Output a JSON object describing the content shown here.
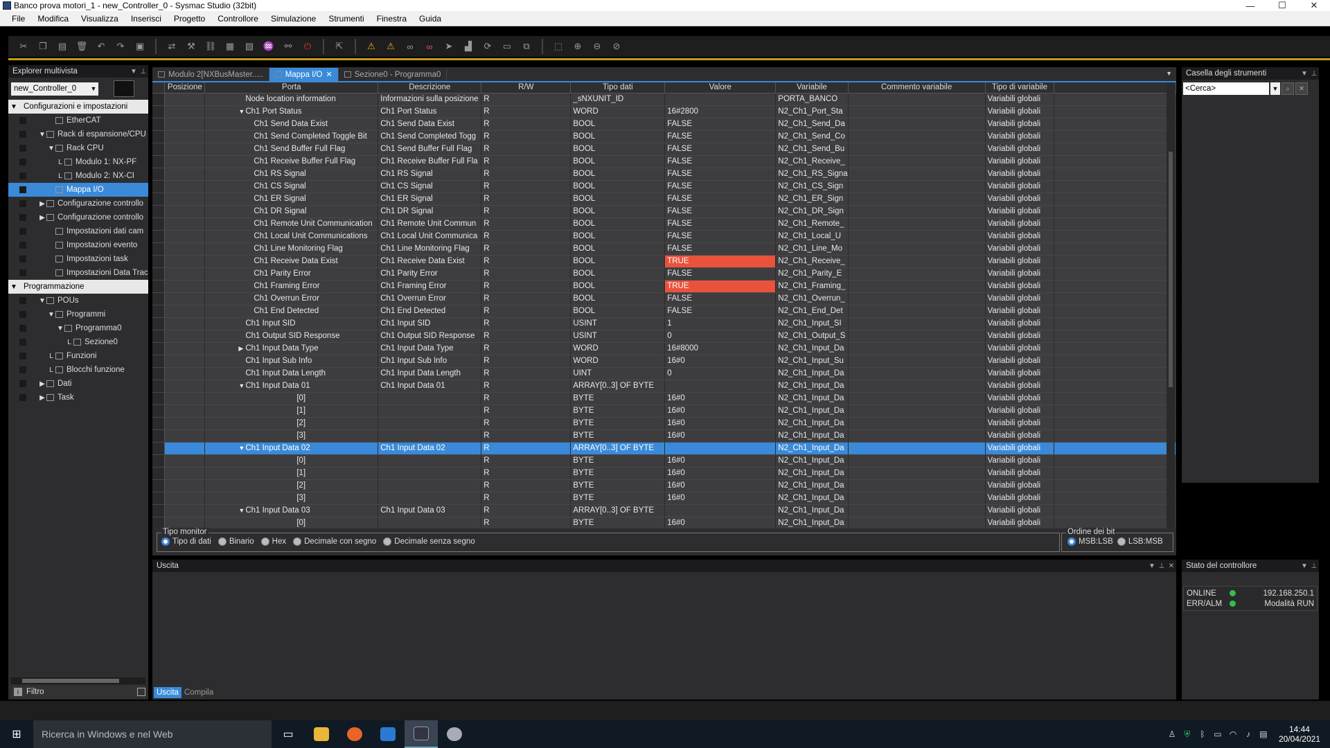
{
  "window": {
    "title": "Banco prova motori_1 - new_Controller_0 - Sysmac Studio (32bit)"
  },
  "menu": [
    "File",
    "Modifica",
    "Visualizza",
    "Inserisci",
    "Progetto",
    "Controllore",
    "Simulazione",
    "Strumenti",
    "Finestra",
    "Guida"
  ],
  "explorer": {
    "title": "Explorer multivista",
    "controller": "new_Controller_0",
    "tree": [
      {
        "label": "Configurazioni e impostazioni",
        "level": 0,
        "exp": "▼",
        "group": true
      },
      {
        "label": "EtherCAT",
        "level": 2,
        "exp": ""
      },
      {
        "label": "Rack di espansione/CPU",
        "level": 1,
        "exp": "▼"
      },
      {
        "label": "Rack CPU",
        "level": 2,
        "exp": "▼"
      },
      {
        "label": "Modulo 1: NX-PF",
        "level": 3,
        "exp": "L"
      },
      {
        "label": "Modulo 2: NX-CI",
        "level": 3,
        "exp": "L"
      },
      {
        "label": "Mappa I/O",
        "level": 2,
        "exp": "",
        "sel": true
      },
      {
        "label": "Configurazione controllo",
        "level": 1,
        "exp": "▶"
      },
      {
        "label": "Configurazione controllo",
        "level": 1,
        "exp": "▶"
      },
      {
        "label": "Impostazioni dati cam",
        "level": 2,
        "exp": ""
      },
      {
        "label": "Impostazioni evento",
        "level": 2,
        "exp": ""
      },
      {
        "label": "Impostazioni task",
        "level": 2,
        "exp": ""
      },
      {
        "label": "Impostazioni Data Trace",
        "level": 2,
        "exp": ""
      },
      {
        "label": "Programmazione",
        "level": 0,
        "exp": "▼",
        "group": true
      },
      {
        "label": "POUs",
        "level": 1,
        "exp": "▼"
      },
      {
        "label": "Programmi",
        "level": 2,
        "exp": "▼"
      },
      {
        "label": "Programma0",
        "level": 3,
        "exp": "▼"
      },
      {
        "label": "Sezione0",
        "level": 4,
        "exp": "L"
      },
      {
        "label": "Funzioni",
        "level": 2,
        "exp": "L"
      },
      {
        "label": "Blocchi funzione",
        "level": 2,
        "exp": "L"
      },
      {
        "label": "Dati",
        "level": 1,
        "exp": "▶"
      },
      {
        "label": "Task",
        "level": 1,
        "exp": "▶"
      }
    ],
    "filter_label": "Filtro"
  },
  "tabs": [
    {
      "label": "Modulo 2[NXBusMaster.....",
      "active": false,
      "close": ""
    },
    {
      "label": "Mappa I/O",
      "active": true,
      "close": "✕"
    },
    {
      "label": "Sezione0 - Programma0",
      "active": false,
      "close": ""
    }
  ],
  "grid": {
    "columns": [
      "Posizione",
      "Porta",
      "Descrizione",
      "R/W",
      "Tipo dati",
      "Valore",
      "Variabile",
      "Commento variabile",
      "Tipo di variabile"
    ],
    "rows": [
      {
        "port": "Node location information",
        "indent": 1,
        "exp": "",
        "desc": "Informazioni sulla posizione",
        "rw": "R",
        "type": "_sNXUNIT_ID",
        "value": "",
        "var": "PORTA_BANCO",
        "vtype": "Variabili globali"
      },
      {
        "port": "Ch1 Port Status",
        "indent": 1,
        "exp": "▼",
        "desc": "Ch1 Port Status",
        "rw": "R",
        "type": "WORD",
        "value": "16#2800",
        "var": "N2_Ch1_Port_Sta",
        "vtype": "Variabili globali"
      },
      {
        "port": "Ch1 Send Data Exist",
        "indent": 2,
        "exp": "",
        "desc": "Ch1 Send Data Exist",
        "rw": "R",
        "type": "BOOL",
        "value": "FALSE",
        "var": "N2_Ch1_Send_Da",
        "vtype": "Variabili globali"
      },
      {
        "port": "Ch1 Send Completed Toggle Bit",
        "indent": 2,
        "exp": "",
        "desc": "Ch1 Send Completed Togg",
        "rw": "R",
        "type": "BOOL",
        "value": "FALSE",
        "var": "N2_Ch1_Send_Co",
        "vtype": "Variabili globali"
      },
      {
        "port": "Ch1 Send Buffer Full Flag",
        "indent": 2,
        "exp": "",
        "desc": "Ch1 Send Buffer Full Flag",
        "rw": "R",
        "type": "BOOL",
        "value": "FALSE",
        "var": "N2_Ch1_Send_Bu",
        "vtype": "Variabili globali"
      },
      {
        "port": "Ch1 Receive Buffer Full Flag",
        "indent": 2,
        "exp": "",
        "desc": "Ch1 Receive Buffer Full Fla",
        "rw": "R",
        "type": "BOOL",
        "value": "FALSE",
        "var": "N2_Ch1_Receive_",
        "vtype": "Variabili globali"
      },
      {
        "port": "Ch1 RS Signal",
        "indent": 2,
        "exp": "",
        "desc": "Ch1 RS Signal",
        "rw": "R",
        "type": "BOOL",
        "value": "FALSE",
        "var": "N2_Ch1_RS_Signa",
        "vtype": "Variabili globali"
      },
      {
        "port": "Ch1 CS Signal",
        "indent": 2,
        "exp": "",
        "desc": "Ch1 CS Signal",
        "rw": "R",
        "type": "BOOL",
        "value": "FALSE",
        "var": "N2_Ch1_CS_Sign",
        "vtype": "Variabili globali"
      },
      {
        "port": "Ch1 ER Signal",
        "indent": 2,
        "exp": "",
        "desc": "Ch1 ER Signal",
        "rw": "R",
        "type": "BOOL",
        "value": "FALSE",
        "var": "N2_Ch1_ER_Sign",
        "vtype": "Variabili globali"
      },
      {
        "port": "Ch1 DR Signal",
        "indent": 2,
        "exp": "",
        "desc": "Ch1 DR Signal",
        "rw": "R",
        "type": "BOOL",
        "value": "FALSE",
        "var": "N2_Ch1_DR_Sign",
        "vtype": "Variabili globali"
      },
      {
        "port": "Ch1 Remote Unit Communication",
        "indent": 2,
        "exp": "",
        "desc": "Ch1 Remote Unit Commun",
        "rw": "R",
        "type": "BOOL",
        "value": "FALSE",
        "var": "N2_Ch1_Remote_",
        "vtype": "Variabili globali"
      },
      {
        "port": "Ch1 Local Unit Communications",
        "indent": 2,
        "exp": "",
        "desc": "Ch1 Local Unit Communica",
        "rw": "R",
        "type": "BOOL",
        "value": "FALSE",
        "var": "N2_Ch1_Local_U",
        "vtype": "Variabili globali"
      },
      {
        "port": "Ch1 Line Monitoring Flag",
        "indent": 2,
        "exp": "",
        "desc": "Ch1 Line Monitoring Flag",
        "rw": "R",
        "type": "BOOL",
        "value": "FALSE",
        "var": "N2_Ch1_Line_Mo",
        "vtype": "Variabili globali"
      },
      {
        "port": "Ch1 Receive Data Exist",
        "indent": 2,
        "exp": "",
        "desc": "Ch1 Receive Data Exist",
        "rw": "R",
        "type": "BOOL",
        "value": "TRUE",
        "hl": true,
        "var": "N2_Ch1_Receive_",
        "vtype": "Variabili globali"
      },
      {
        "port": "Ch1 Parity Error",
        "indent": 2,
        "exp": "",
        "desc": "Ch1 Parity Error",
        "rw": "R",
        "type": "BOOL",
        "value": "FALSE",
        "var": "N2_Ch1_Parity_E",
        "vtype": "Variabili globali"
      },
      {
        "port": "Ch1 Framing Error",
        "indent": 2,
        "exp": "",
        "desc": "Ch1 Framing Error",
        "rw": "R",
        "type": "BOOL",
        "value": "TRUE",
        "hl": true,
        "var": "N2_Ch1_Framing_",
        "vtype": "Variabili globali"
      },
      {
        "port": "Ch1 Overrun Error",
        "indent": 2,
        "exp": "",
        "desc": "Ch1 Overrun Error",
        "rw": "R",
        "type": "BOOL",
        "value": "FALSE",
        "var": "N2_Ch1_Overrun_",
        "vtype": "Variabili globali"
      },
      {
        "port": "Ch1 End Detected",
        "indent": 2,
        "exp": "",
        "desc": "Ch1 End Detected",
        "rw": "R",
        "type": "BOOL",
        "value": "FALSE",
        "var": "N2_Ch1_End_Det",
        "vtype": "Variabili globali"
      },
      {
        "port": "Ch1 Input SID",
        "indent": 1,
        "exp": "",
        "desc": "Ch1 Input SID",
        "rw": "R",
        "type": "USINT",
        "value": "1",
        "var": "N2_Ch1_Input_SI",
        "vtype": "Variabili globali"
      },
      {
        "port": "Ch1 Output SID Response",
        "indent": 1,
        "exp": "",
        "desc": "Ch1 Output SID Response",
        "rw": "R",
        "type": "USINT",
        "value": "0",
        "var": "N2_Ch1_Output_S",
        "vtype": "Variabili globali"
      },
      {
        "port": "Ch1 Input Data Type",
        "indent": 1,
        "exp": "▶",
        "desc": "Ch1 Input Data Type",
        "rw": "R",
        "type": "WORD",
        "value": "16#8000",
        "var": "N2_Ch1_Input_Da",
        "vtype": "Variabili globali"
      },
      {
        "port": "Ch1 Input Sub Info",
        "indent": 1,
        "exp": "",
        "desc": "Ch1 Input Sub Info",
        "rw": "R",
        "type": "WORD",
        "value": "16#0",
        "var": "N2_Ch1_Input_Su",
        "vtype": "Variabili globali"
      },
      {
        "port": "Ch1 Input Data Length",
        "indent": 1,
        "exp": "",
        "desc": "Ch1 Input Data Length",
        "rw": "R",
        "type": "UINT",
        "value": "0",
        "var": "N2_Ch1_Input_Da",
        "vtype": "Variabili globali"
      },
      {
        "port": "Ch1 Input Data 01",
        "indent": 1,
        "exp": "▼",
        "desc": "Ch1 Input Data 01",
        "rw": "R",
        "type": "ARRAY[0..3] OF BYTE",
        "value": "",
        "var": "N2_Ch1_Input_Da",
        "vtype": "Variabili globali"
      },
      {
        "port": "[0]",
        "indent": 3,
        "exp": "",
        "desc": "",
        "rw": "R",
        "type": "BYTE",
        "value": "16#0",
        "var": "N2_Ch1_Input_Da",
        "vtype": "Variabili globali"
      },
      {
        "port": "[1]",
        "indent": 3,
        "exp": "",
        "desc": "",
        "rw": "R",
        "type": "BYTE",
        "value": "16#0",
        "var": "N2_Ch1_Input_Da",
        "vtype": "Variabili globali"
      },
      {
        "port": "[2]",
        "indent": 3,
        "exp": "",
        "desc": "",
        "rw": "R",
        "type": "BYTE",
        "value": "16#0",
        "var": "N2_Ch1_Input_Da",
        "vtype": "Variabili globali"
      },
      {
        "port": "[3]",
        "indent": 3,
        "exp": "",
        "desc": "",
        "rw": "R",
        "type": "BYTE",
        "value": "16#0",
        "var": "N2_Ch1_Input_Da",
        "vtype": "Variabili globali"
      },
      {
        "port": "Ch1 Input Data 02",
        "indent": 1,
        "exp": "▼",
        "desc": "Ch1 Input Data 02",
        "rw": "R",
        "type": "ARRAY[0..3] OF BYTE",
        "value": "",
        "var": "N2_Ch1_Input_Da",
        "vtype": "Variabili globali",
        "sel": true
      },
      {
        "port": "[0]",
        "indent": 3,
        "exp": "",
        "desc": "",
        "rw": "R",
        "type": "BYTE",
        "value": "16#0",
        "var": "N2_Ch1_Input_Da",
        "vtype": "Variabili globali"
      },
      {
        "port": "[1]",
        "indent": 3,
        "exp": "",
        "desc": "",
        "rw": "R",
        "type": "BYTE",
        "value": "16#0",
        "var": "N2_Ch1_Input_Da",
        "vtype": "Variabili globali"
      },
      {
        "port": "[2]",
        "indent": 3,
        "exp": "",
        "desc": "",
        "rw": "R",
        "type": "BYTE",
        "value": "16#0",
        "var": "N2_Ch1_Input_Da",
        "vtype": "Variabili globali"
      },
      {
        "port": "[3]",
        "indent": 3,
        "exp": "",
        "desc": "",
        "rw": "R",
        "type": "BYTE",
        "value": "16#0",
        "var": "N2_Ch1_Input_Da",
        "vtype": "Variabili globali"
      },
      {
        "port": "Ch1 Input Data 03",
        "indent": 1,
        "exp": "▼",
        "desc": "Ch1 Input Data 03",
        "rw": "R",
        "type": "ARRAY[0..3] OF BYTE",
        "value": "",
        "var": "N2_Ch1_Input_Da",
        "vtype": "Variabili globali"
      },
      {
        "port": "[0]",
        "indent": 3,
        "exp": "",
        "desc": "",
        "rw": "R",
        "type": "BYTE",
        "value": "16#0",
        "var": "N2_Ch1_Input_Da",
        "vtype": "Variabili globali"
      }
    ]
  },
  "monitor": {
    "legend": "Tipo monitor",
    "options": [
      "Tipo di dati",
      "Binario",
      "Hex",
      "Decimale con segno",
      "Decimale senza segno"
    ],
    "selected": 0,
    "bit_order_legend": "Ordine dei bit",
    "bit_options": [
      "MSB:LSB",
      "LSB:MSB"
    ],
    "bit_selected": 0
  },
  "output": {
    "title": "Uscita",
    "tabs": [
      "Uscita",
      "Compila"
    ]
  },
  "toolbox": {
    "title": "Casella degli strumenti",
    "search_placeholder": "<Cerca>"
  },
  "controller_state": {
    "title": "Stato del controllore",
    "rows": [
      {
        "k": "ONLINE",
        "v": "192.168.250.1"
      },
      {
        "k": "ERR/ALM",
        "v": "Modalità RUN"
      }
    ]
  },
  "taskbar": {
    "search": "Ricerca in Windows e nel Web",
    "time": "14:44",
    "date": "20/04/2021"
  },
  "colors": {
    "accent": "#3a8ad9",
    "highlight_true": "#e9533c",
    "status_green": "#2ec04a"
  }
}
